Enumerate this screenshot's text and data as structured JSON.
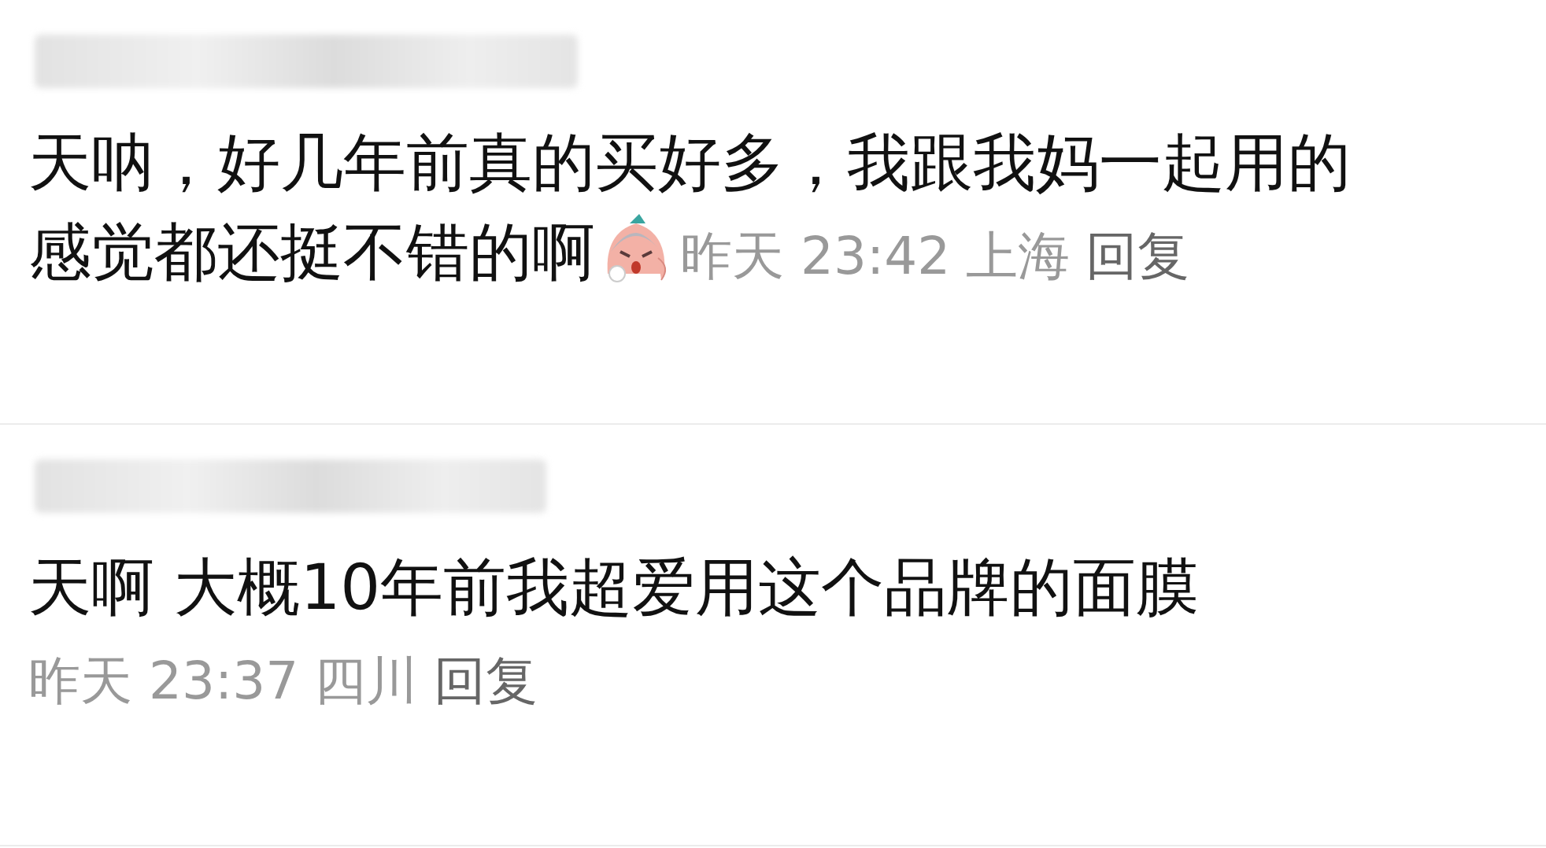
{
  "comments": [
    {
      "lines": [
        "天呐，好几年前真的买好多，我跟我妈一起用的",
        "感觉都还挺不错的啊"
      ],
      "emoji": true,
      "time": "昨天 23:42",
      "location": "上海",
      "reply": "回复"
    },
    {
      "lines": [
        "天啊 大概10年前我超爱用这个品牌的面膜"
      ],
      "time": "昨天 23:37",
      "location": "四川",
      "reply": "回复"
    }
  ]
}
